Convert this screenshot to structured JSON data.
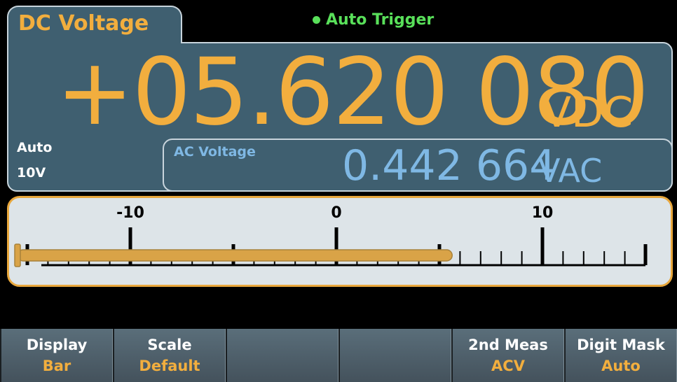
{
  "colors": {
    "accent": "#f2ae3e",
    "trigger": "#59e05a",
    "secondary": "#7fb8e4",
    "panel": "#3f5f70",
    "bar_fill": "#d9a347"
  },
  "function_tab": {
    "label": "DC Voltage"
  },
  "trigger": {
    "label": "Auto Trigger"
  },
  "primary": {
    "value": "+05.620 080",
    "unit": "VDC"
  },
  "range": {
    "mode": "Auto",
    "value": "10V"
  },
  "secondary": {
    "label": "AC Voltage",
    "value": "0.442 664",
    "unit": "VAC"
  },
  "bar_meter": {
    "min": -15,
    "max": 15,
    "reading": 5.62008,
    "ticks_major": [
      -10,
      0,
      10
    ],
    "tick_labels": [
      "-10",
      "0",
      "10"
    ]
  },
  "softkeys": [
    {
      "name": "Display",
      "value": "Bar"
    },
    {
      "name": "Scale",
      "value": "Default"
    },
    {
      "name": "",
      "value": ""
    },
    {
      "name": "",
      "value": ""
    },
    {
      "name": "2nd Meas",
      "value": "ACV"
    },
    {
      "name": "Digit Mask",
      "value": "Auto"
    }
  ]
}
